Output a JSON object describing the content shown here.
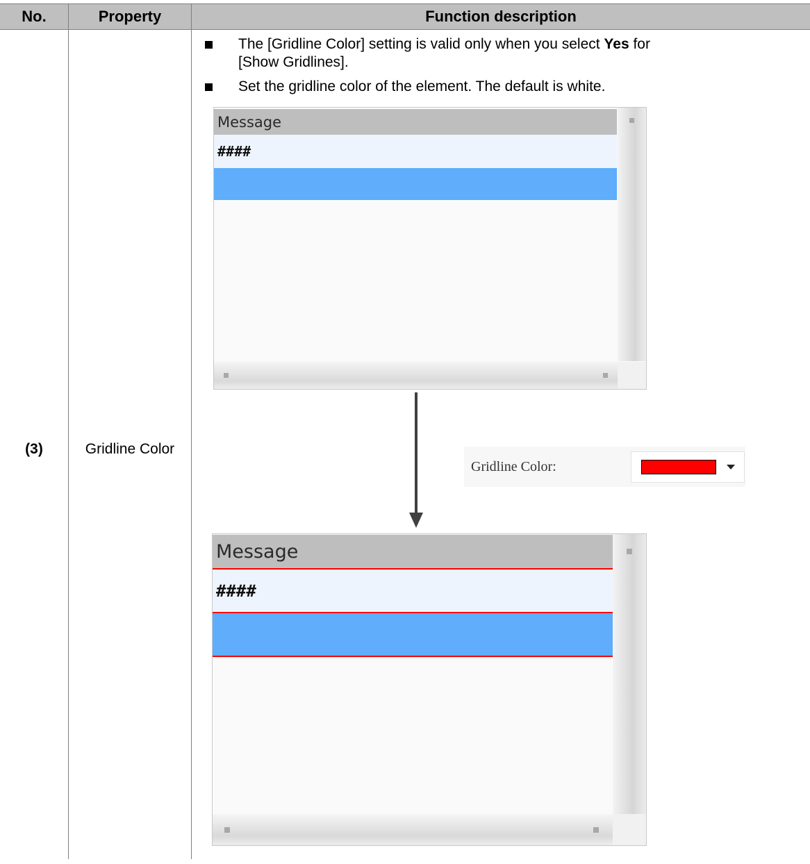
{
  "table": {
    "headers": {
      "no": "No.",
      "property": "Property",
      "description": "Function description"
    },
    "row": {
      "no": "(3)",
      "property": "Gridline Color",
      "bullets": [
        {
          "pre": "The [Gridline Color] setting is valid only when you select ",
          "bold": "Yes",
          "post": " for",
          "line2": "[Show Gridlines]."
        },
        {
          "text": "Set the gridline color of the element. The default is white."
        }
      ]
    }
  },
  "widget_before": {
    "header": "Message",
    "row_text": "####"
  },
  "widget_after": {
    "header": "Message",
    "row_text": "####",
    "gridline_color": "#ff0000"
  },
  "gridline_setting": {
    "label": "Gridline Color:",
    "swatch_color": "#ff0000"
  },
  "colors": {
    "header_bg": "#bfbfbf",
    "selected_row": "#5fadfb",
    "row_bg": "#eef4fd"
  }
}
